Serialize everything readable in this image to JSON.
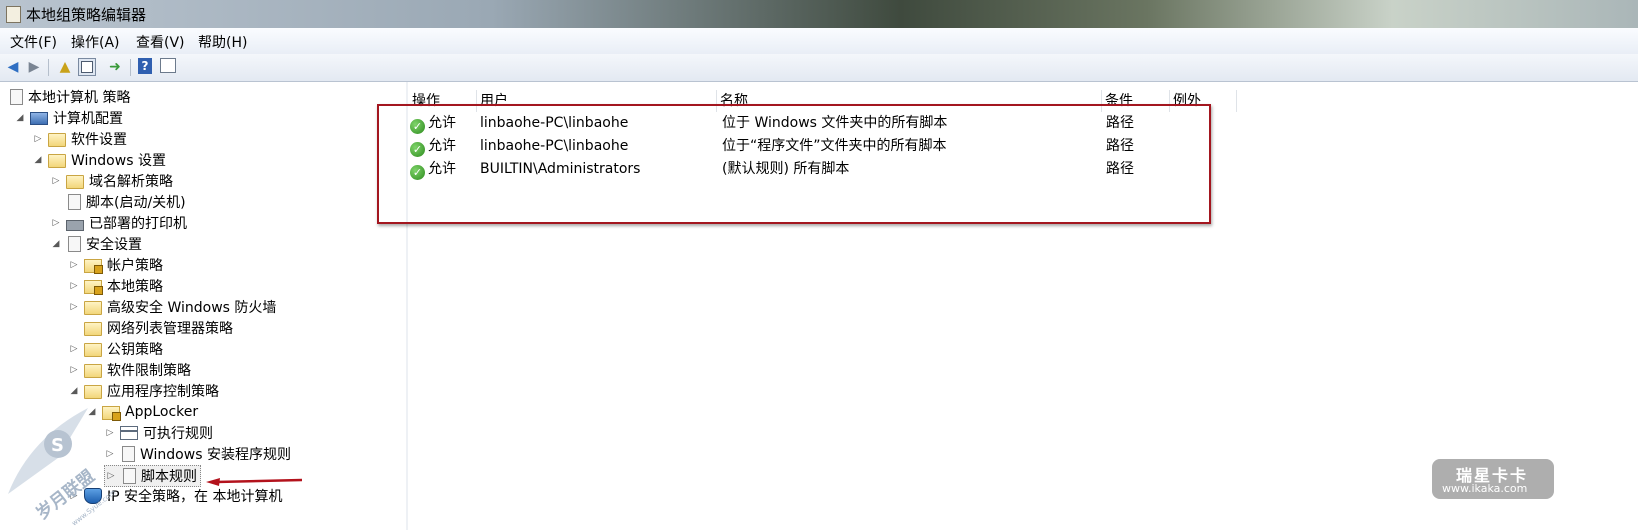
{
  "window": {
    "title": "本地组策略编辑器"
  },
  "menu": {
    "items": [
      "文件(F)",
      "操作(A)",
      "查看(V)",
      "帮助(H)"
    ]
  },
  "tree": {
    "root": "本地计算机 策略",
    "computer_config": "计算机配置",
    "software_settings": "软件设置",
    "windows_settings": "Windows 设置",
    "dns_policy": "域名解析策略",
    "scripts": "脚本(启动/关机)",
    "deployed_printers": "已部署的打印机",
    "security_settings": "安全设置",
    "account_policy": "帐户策略",
    "local_policy": "本地策略",
    "firewall": "高级安全 Windows 防火墙",
    "network_list": "网络列表管理器策略",
    "public_key": "公钥策略",
    "software_restriction": "软件限制策略",
    "app_control": "应用程序控制策略",
    "applocker": "AppLocker",
    "exe_rules": "可执行规则",
    "installer_rules": "Windows 安装程序规则",
    "script_rules": "脚本规则",
    "ip_security": "IP 安全策略，在 本地计算机"
  },
  "list": {
    "columns": [
      "操作",
      "用户",
      "名称",
      "条件",
      "例外"
    ],
    "rows": [
      {
        "action": "允许",
        "user": "linbaohe-PC\\linbaohe",
        "name": "位于 Windows 文件夹中的所有脚本",
        "condition": "路径",
        "exception": ""
      },
      {
        "action": "允许",
        "user": "linbaohe-PC\\linbaohe",
        "name": "位于“程序文件”文件夹中的所有脚本",
        "condition": "路径",
        "exception": ""
      },
      {
        "action": "允许",
        "user": "BUILTIN\\Administrators",
        "name": "(默认规则) 所有脚本",
        "condition": "路径",
        "exception": ""
      }
    ]
  },
  "watermarks": {
    "left_text": "岁月联盟",
    "left_url": "www.Syue.com",
    "right_text": "瑞星卡卡",
    "right_url": "www.ikaka.com"
  },
  "colors": {
    "highlight": "#a3161f",
    "allow": "#2c8a1d"
  }
}
